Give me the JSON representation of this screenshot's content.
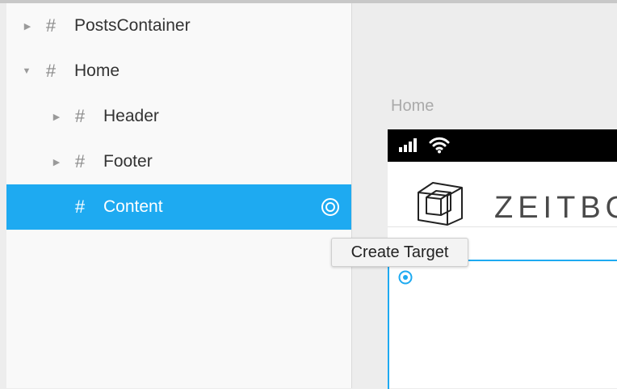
{
  "layers": {
    "items": [
      {
        "label": "PostsContainer",
        "expanded": false,
        "selected": false,
        "level": 0
      },
      {
        "label": "Home",
        "expanded": true,
        "selected": false,
        "level": 0
      },
      {
        "label": "Header",
        "expanded": false,
        "selected": false,
        "level": 1
      },
      {
        "label": "Footer",
        "expanded": false,
        "selected": false,
        "level": 1
      },
      {
        "label": "Content",
        "expanded": null,
        "selected": true,
        "level": 1
      }
    ],
    "row_icon": "hash-icon",
    "selected_action_icon": "target-icon"
  },
  "canvas": {
    "frame_title": "Home",
    "brand_text": "ZEITBO",
    "logo_icon": "cube-logo-icon"
  },
  "tooltip": {
    "text": "Create Target"
  },
  "colors": {
    "selection": "#1eaaf1",
    "panel_bg": "#f9f9f9",
    "canvas_bg": "#ededed",
    "status_bar": "#000000"
  }
}
